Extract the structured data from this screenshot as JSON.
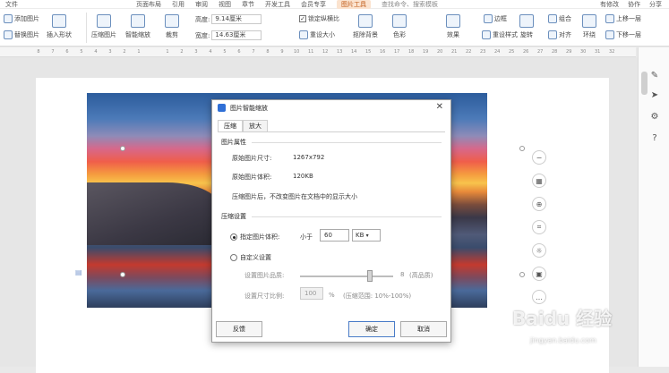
{
  "menubar": {
    "items": [
      "文件",
      "页面布局",
      "引用",
      "审阅",
      "视图",
      "章节",
      "开发工具",
      "会员专享",
      "图片工具"
    ],
    "active_index": 8,
    "search_placeholder": "查找命令、搜索模板",
    "right": [
      "有修改",
      "协作",
      "分享"
    ]
  },
  "ribbon": {
    "add_picture": "添加图片",
    "replace_picture": "替换图片",
    "insert_shape": "插入形状",
    "compress_picture": "压缩图片",
    "smart_scale": "智能缩放",
    "crop": "裁剪",
    "height_label": "高度:",
    "height_value": "9.14厘米",
    "width_label": "宽度:",
    "width_value": "14.63厘米",
    "lock_ratio": "锁定纵横比",
    "reset_size": "重设大小",
    "remove_background": "抠除背景",
    "color": "色彩",
    "effects": "效果",
    "reset_style": "重设样式",
    "border": "边框",
    "rotate": "旋转",
    "combine": "组合",
    "align": "对齐",
    "wrap": "环绕",
    "up_one": "上移一层",
    "down_one": "下移一层"
  },
  "ruler_ticks": [
    "8",
    "7",
    "6",
    "5",
    "4",
    "3",
    "2",
    "1",
    "",
    "1",
    "2",
    "3",
    "4",
    "5",
    "6",
    "7",
    "8",
    "9",
    "10",
    "11",
    "12",
    "13",
    "14",
    "15",
    "16",
    "17",
    "18",
    "19",
    "20",
    "21",
    "22",
    "23",
    "24",
    "25",
    "26",
    "27",
    "28",
    "29",
    "30",
    "31",
    "32",
    "33",
    "34",
    "35",
    "36",
    "37",
    "38",
    "39",
    "40",
    "41",
    "42",
    "43",
    "44",
    "45",
    "46",
    "47",
    "48"
  ],
  "dialog": {
    "title": "图片智能缩放",
    "tabs": [
      "压缩",
      "放大"
    ],
    "active_tab": 0,
    "section_properties": "图片属性",
    "orig_size_label": "原始图片尺寸:",
    "orig_size_value": "1267x792",
    "orig_volume_label": "原始图片体积:",
    "orig_volume_value": "120KB",
    "note": "压缩图片后，不改变图片在文档中的显示大小",
    "section_compress": "压缩设置",
    "option_volume": "指定图片体积:",
    "less_than": "小于",
    "volume_value": "60",
    "volume_unit": "KB",
    "option_custom": "自定义设置",
    "quality_label": "设置图片品质:",
    "quality_value": "8",
    "quality_text": "(高品质)",
    "ratio_label": "设置尺寸比例:",
    "ratio_value": "100",
    "ratio_unit": "%",
    "ratio_range": "(压缩范围: 10%-100%)",
    "feedback_button": "反馈",
    "ok_button": "确定",
    "cancel_button": "取消"
  },
  "watermark": {
    "main": "Baidu 经验",
    "sub": "jingyan.baidu.com"
  },
  "colors": {
    "accent": "#2f6fd6",
    "active_menu_bg": "#fbe3cf"
  }
}
